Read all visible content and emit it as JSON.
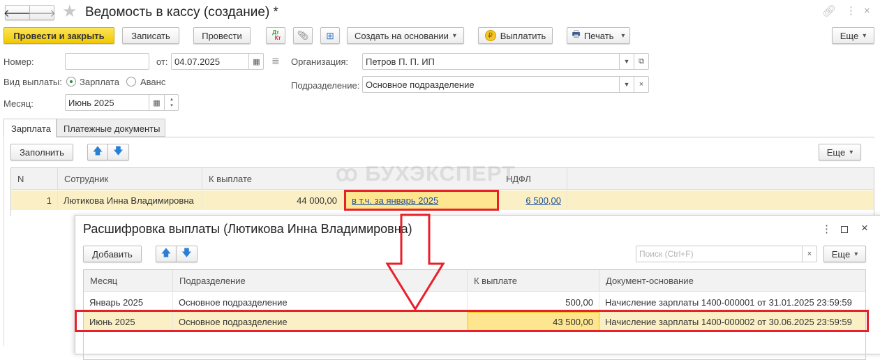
{
  "window": {
    "title": "Ведомость в кассу (создание) *",
    "icons": [
      "back-icon",
      "forward-icon",
      "star-icon",
      "link-icon",
      "more-icon",
      "close-icon"
    ]
  },
  "toolbar": {
    "post_close": "Провести и закрыть",
    "save": "Записать",
    "post": "Провести",
    "dt": "Дт",
    "kt": "Кт",
    "create_based": "Создать на основании",
    "pay": "Выплатить",
    "print": "Печать",
    "more": "Еще"
  },
  "form": {
    "number_label": "Номер:",
    "number_value": "",
    "date_label": "от:",
    "date_value": "04.07.2025",
    "org_label": "Организация:",
    "org_value": "Петров П. П. ИП",
    "pay_type_label": "Вид выплаты:",
    "pay_type_options": [
      "Зарплата",
      "Аванс"
    ],
    "pay_type_selected": "Зарплата",
    "dept_label": "Подразделение:",
    "dept_value": "Основное подразделение",
    "month_label": "Месяц:",
    "month_value": "Июнь 2025"
  },
  "tabs": [
    {
      "label": "Зарплата",
      "active": true
    },
    {
      "label": "Платежные документы",
      "active": false
    }
  ],
  "tab_toolbar": {
    "fill": "Заполнить",
    "more": "Еще"
  },
  "watermark": "БУХЭКСПЕРТ",
  "main_table": {
    "columns": [
      "N",
      "Сотрудник",
      "К выплате",
      "",
      "НДФЛ"
    ],
    "rows": [
      {
        "n": "1",
        "employee": "Лютикова Инна Владимировна",
        "amount": "44 000,00",
        "incl": "в т.ч. за январь 2025",
        "ndfl": "6 500,00"
      }
    ]
  },
  "dialog": {
    "title": "Расшифровка выплаты (Лютикова Инна Владимировна)",
    "add": "Добавить",
    "search_placeholder": "Поиск (Ctrl+F)",
    "more": "Еще",
    "columns": [
      "Месяц",
      "Подразделение",
      "К выплате",
      "Документ-основание"
    ],
    "rows": [
      {
        "month": "Январь 2025",
        "dept": "Основное подразделение",
        "amount": "500,00",
        "doc": "Начисление зарплаты 1400-000001 от 31.01.2025 23:59:59"
      },
      {
        "month": "Июнь 2025",
        "dept": "Основное подразделение",
        "amount": "43 500,00",
        "doc": "Начисление зарплаты 1400-000002 от 30.06.2025 23:59:59"
      }
    ]
  },
  "colors": {
    "accent_yellow": "#f0c800",
    "highlight_row": "#fbf0c5",
    "highlight_cell": "#fde68f",
    "annotation_red": "#e8202a"
  }
}
